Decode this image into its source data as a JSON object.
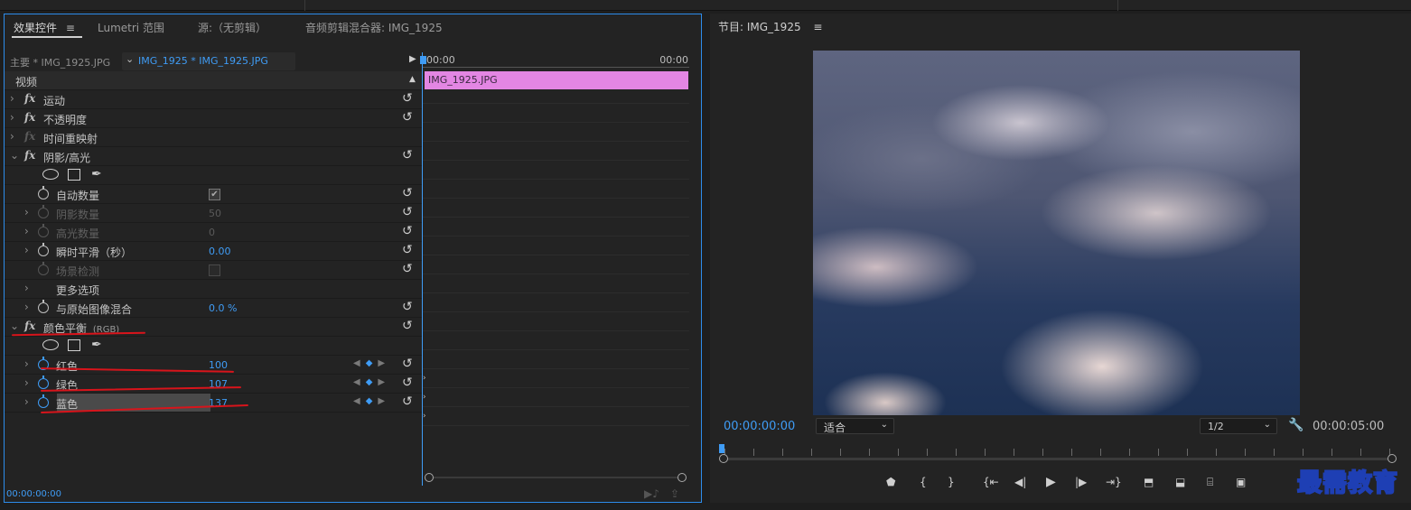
{
  "tabs": [
    {
      "label": "效果控件",
      "active": true
    },
    {
      "label": "Lumetri 范围",
      "active": false
    },
    {
      "label": "源:（无剪辑）",
      "active": false
    },
    {
      "label": "音频剪辑混合器: IMG_1925",
      "active": false
    }
  ],
  "menu_glyph": "≡",
  "seq": {
    "source": "主要 * IMG_1925.JPG",
    "clip": "IMG_1925 * IMG_1925.JPG"
  },
  "video_header": "视频",
  "effects": {
    "motion": "运动",
    "opacity": "不透明度",
    "time_remap": "时间重映射",
    "shadow_highlight": "阴影/高光",
    "auto_amount": "自动数量",
    "shadow_amount": "阴影数量",
    "shadow_amount_val": "50",
    "highlight_amount": "高光数量",
    "highlight_amount_val": "0",
    "temporal_smoothing": "瞬时平滑（秒）",
    "temporal_smoothing_val": "0.00",
    "scene_detect": "场景检测",
    "more_options": "更多选项",
    "blend_original": "与原始图像混合",
    "blend_original_val": "0.0 %",
    "color_balance": "颜色平衡",
    "color_balance_suffix": "(RGB)",
    "red": "红色",
    "red_val": "100",
    "green": "绿色",
    "green_val": "107",
    "blue": "蓝色",
    "blue_val": "137"
  },
  "mini_timeline": {
    "start": "00:00",
    "end": "00:00",
    "clip_name": "IMG_1925.JPG"
  },
  "ec_footer_timecode": "00:00:00:00",
  "program": {
    "title": "节目: IMG_1925",
    "current_timecode": "00:00:00:00",
    "fit": "适合",
    "resolution": "1/2",
    "duration": "00:00:05:00"
  },
  "watermark": "最需教育",
  "colors": {
    "accent_blue": "#3f9cf5",
    "clip_pink": "#e386e3",
    "annotation_red": "#d8141b",
    "panel_bg": "#232323"
  }
}
